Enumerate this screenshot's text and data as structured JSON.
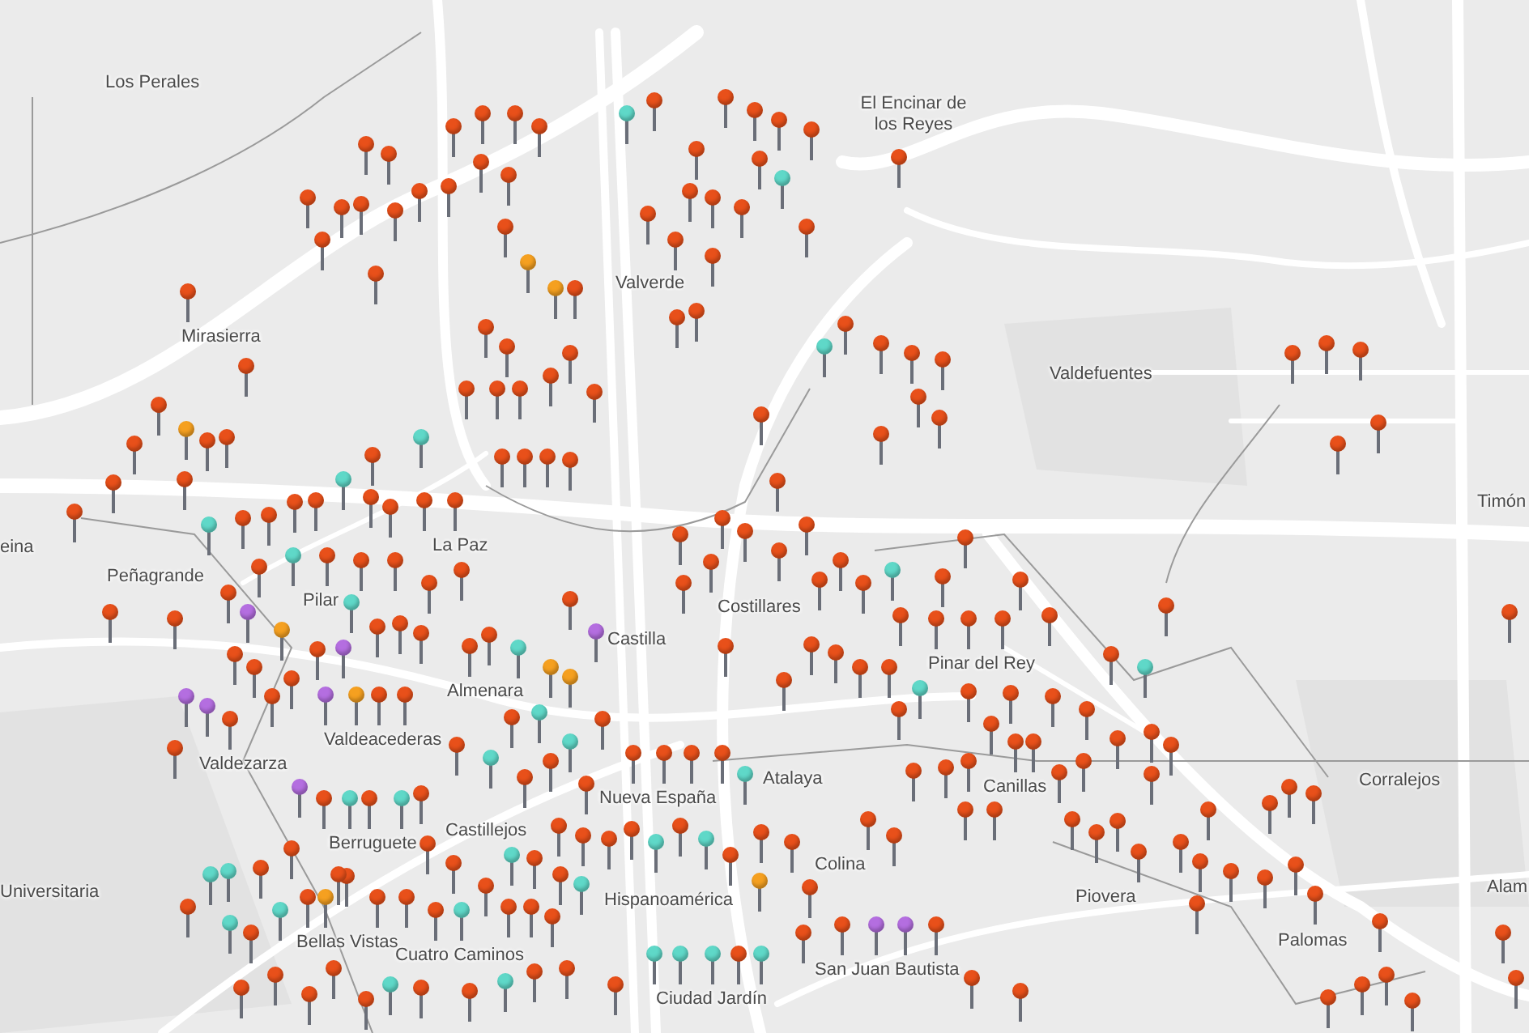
{
  "map": {
    "place_labels": [
      {
        "text": "Los Perales"
      },
      {
        "text": "El Encinar de los Reyes"
      },
      {
        "text": "Valverde"
      },
      {
        "text": "Mirasierra"
      },
      {
        "text": "Valdefuentes"
      },
      {
        "text": "Timón"
      },
      {
        "text": "eina"
      },
      {
        "text": "Peñagrande"
      },
      {
        "text": "La Paz"
      },
      {
        "text": "Pilar"
      },
      {
        "text": "Costillares"
      },
      {
        "text": "Castilla"
      },
      {
        "text": "Pinar del Rey"
      },
      {
        "text": "Almenara"
      },
      {
        "text": "Valdeacederas"
      },
      {
        "text": "Valdezarza"
      },
      {
        "text": "Atalaya"
      },
      {
        "text": "Canillas"
      },
      {
        "text": "Corralejos"
      },
      {
        "text": "Nueva España"
      },
      {
        "text": "Castillejos"
      },
      {
        "text": "Berruguete"
      },
      {
        "text": "Colina"
      },
      {
        "text": "Alam"
      },
      {
        "text": "Universitaria"
      },
      {
        "text": "Hispanoamérica"
      },
      {
        "text": "Piovera"
      },
      {
        "text": "Palomas"
      },
      {
        "text": "Bellas Vistas"
      },
      {
        "text": "Cuatro Caminos"
      },
      {
        "text": "San Juan Bautista"
      },
      {
        "text": "Ciudad Jardín"
      }
    ],
    "pins": [
      {
        "color": "#e8501a"
      },
      {
        "color": "#e8501a"
      },
      {
        "color": "#e8501a"
      },
      {
        "color": "#e8501a"
      },
      {
        "color": "#e8501a"
      },
      {
        "color": "#e8501a"
      },
      {
        "color": "#e8501a"
      },
      {
        "color": "#e8501a"
      },
      {
        "color": "#e8501a"
      },
      {
        "color": "#e8501a"
      },
      {
        "color": "#e8501a"
      },
      {
        "color": "#e8501a"
      },
      {
        "color": "#e8501a"
      },
      {
        "color": "#e8501a"
      },
      {
        "color": "#e8501a"
      },
      {
        "color": "#e8501a"
      },
      {
        "color": "#e8501a"
      },
      {
        "color": "#5fd8c8"
      },
      {
        "color": "#e8501a"
      },
      {
        "color": "#e8501a"
      },
      {
        "color": "#e8501a"
      },
      {
        "color": "#e8501a"
      },
      {
        "color": "#e8501a"
      },
      {
        "color": "#5fd8c8"
      },
      {
        "color": "#e8501a"
      },
      {
        "color": "#e8501a"
      },
      {
        "color": "#e8501a"
      },
      {
        "color": "#e8501a"
      },
      {
        "color": "#e8501a"
      },
      {
        "color": "#e8501a"
      },
      {
        "color": "#e8501a"
      },
      {
        "color": "#e8501a"
      },
      {
        "color": "#e8501a"
      },
      {
        "color": "#e8501a"
      },
      {
        "color": "#f5a020"
      },
      {
        "color": "#f5a020"
      },
      {
        "color": "#e8501a"
      },
      {
        "color": "#e8501a"
      },
      {
        "color": "#e8501a"
      },
      {
        "color": "#e8501a"
      },
      {
        "color": "#e8501a"
      },
      {
        "color": "#e8501a"
      },
      {
        "color": "#e8501a"
      },
      {
        "color": "#e8501a"
      },
      {
        "color": "#e8501a"
      },
      {
        "color": "#e8501a"
      },
      {
        "color": "#e8501a"
      },
      {
        "color": "#e8501a"
      },
      {
        "color": "#e8501a"
      },
      {
        "color": "#e8501a"
      },
      {
        "color": "#e8501a"
      },
      {
        "color": "#e8501a"
      },
      {
        "color": "#e8501a"
      },
      {
        "color": "#e8501a"
      },
      {
        "color": "#e8501a"
      },
      {
        "color": "#5fd8c8"
      },
      {
        "color": "#e8501a"
      },
      {
        "color": "#e8501a"
      },
      {
        "color": "#e8501a"
      },
      {
        "color": "#e8501a"
      },
      {
        "color": "#e8501a"
      },
      {
        "color": "#e8501a"
      },
      {
        "color": "#e8501a"
      },
      {
        "color": "#e8501a"
      },
      {
        "color": "#e8501a"
      },
      {
        "color": "#e8501a"
      },
      {
        "color": "#e8501a"
      },
      {
        "color": "#e8501a"
      },
      {
        "color": "#e8501a"
      },
      {
        "color": "#e8501a"
      },
      {
        "color": "#e8501a"
      },
      {
        "color": "#e8501a"
      },
      {
        "color": "#e8501a"
      },
      {
        "color": "#e8501a"
      },
      {
        "color": "#f5a020"
      },
      {
        "color": "#e8501a"
      },
      {
        "color": "#5fd8c8"
      },
      {
        "color": "#5fd8c8"
      },
      {
        "color": "#e8501a"
      },
      {
        "color": "#e8501a"
      },
      {
        "color": "#e8501a"
      },
      {
        "color": "#5fd8c8"
      },
      {
        "color": "#e8501a"
      },
      {
        "color": "#5fd8c8"
      },
      {
        "color": "#e8501a"
      },
      {
        "color": "#e8501a"
      },
      {
        "color": "#e8501a"
      },
      {
        "color": "#e8501a"
      },
      {
        "color": "#e8501a"
      },
      {
        "color": "#e8501a"
      },
      {
        "color": "#e8501a"
      },
      {
        "color": "#f5a020"
      },
      {
        "color": "#5fd8c8"
      },
      {
        "color": "#e8501a"
      },
      {
        "color": "#e8501a"
      },
      {
        "color": "#e8501a"
      },
      {
        "color": "#e8501a"
      },
      {
        "color": "#e8501a"
      },
      {
        "color": "#e8501a"
      },
      {
        "color": "#e8501a"
      },
      {
        "color": "#e8501a"
      },
      {
        "color": "#e8501a"
      },
      {
        "color": "#e8501a"
      },
      {
        "color": "#b46ee0"
      },
      {
        "color": "#e8501a"
      },
      {
        "color": "#b46ee0"
      },
      {
        "color": "#e8501a"
      },
      {
        "color": "#e8501a"
      },
      {
        "color": "#e8501a"
      },
      {
        "color": "#e8501a"
      },
      {
        "color": "#e8501a"
      },
      {
        "color": "#e8501a"
      },
      {
        "color": "#e8501a"
      },
      {
        "color": "#e8501a"
      },
      {
        "color": "#e8501a"
      },
      {
        "color": "#e8501a"
      },
      {
        "color": "#e8501a"
      },
      {
        "color": "#e8501a"
      },
      {
        "color": "#e8501a"
      },
      {
        "color": "#e8501a"
      },
      {
        "color": "#5fd8c8"
      },
      {
        "color": "#f5a020"
      },
      {
        "color": "#e8501a"
      },
      {
        "color": "#b46ee0"
      },
      {
        "color": "#f5a020"
      },
      {
        "color": "#e8501a"
      },
      {
        "color": "#5fd8c8"
      },
      {
        "color": "#e8501a"
      },
      {
        "color": "#5fd8c8"
      },
      {
        "color": "#e8501a"
      },
      {
        "color": "#e8501a"
      },
      {
        "color": "#5fd8c8"
      },
      {
        "color": "#e8501a"
      },
      {
        "color": "#e8501a"
      },
      {
        "color": "#e8501a"
      },
      {
        "color": "#5fd8c8"
      },
      {
        "color": "#e8501a"
      },
      {
        "color": "#e8501a"
      },
      {
        "color": "#5fd8c8"
      },
      {
        "color": "#e8501a"
      },
      {
        "color": "#e8501a"
      },
      {
        "color": "#e8501a"
      },
      {
        "color": "#5fd8c8"
      },
      {
        "color": "#e8501a"
      },
      {
        "color": "#e8501a"
      },
      {
        "color": "#e8501a"
      },
      {
        "color": "#e8501a"
      },
      {
        "color": "#e8501a"
      },
      {
        "color": "#5fd8c8"
      },
      {
        "color": "#e8501a"
      },
      {
        "color": "#5fd8c8"
      },
      {
        "color": "#e8501a"
      },
      {
        "color": "#e8501a"
      },
      {
        "color": "#5fd8c8"
      },
      {
        "color": "#e8501a"
      },
      {
        "color": "#e8501a"
      },
      {
        "color": "#e8501a"
      },
      {
        "color": "#5fd8c8"
      },
      {
        "color": "#e8501a"
      },
      {
        "color": "#e8501a"
      },
      {
        "color": "#e8501a"
      },
      {
        "color": "#e8501a"
      },
      {
        "color": "#e8501a"
      },
      {
        "color": "#e8501a"
      },
      {
        "color": "#e8501a"
      },
      {
        "color": "#e8501a"
      },
      {
        "color": "#e8501a"
      },
      {
        "color": "#f5a020"
      },
      {
        "color": "#5fd8c8"
      },
      {
        "color": "#e8501a"
      },
      {
        "color": "#e8501a"
      },
      {
        "color": "#5fd8c8"
      },
      {
        "color": "#e8501a"
      },
      {
        "color": "#e8501a"
      },
      {
        "color": "#e8501a"
      },
      {
        "color": "#5fd8c8"
      },
      {
        "color": "#5fd8c8"
      },
      {
        "color": "#5fd8c8"
      },
      {
        "color": "#e8501a"
      },
      {
        "color": "#5fd8c8"
      },
      {
        "color": "#e8501a"
      },
      {
        "color": "#e8501a"
      },
      {
        "color": "#5fd8c8"
      },
      {
        "color": "#e8501a"
      },
      {
        "color": "#e8501a"
      },
      {
        "color": "#e8501a"
      },
      {
        "color": "#e8501a"
      },
      {
        "color": "#e8501a"
      },
      {
        "color": "#e8501a"
      },
      {
        "color": "#5fd8c8"
      },
      {
        "color": "#e8501a"
      },
      {
        "color": "#e8501a"
      },
      {
        "color": "#e8501a"
      },
      {
        "color": "#f5a020"
      },
      {
        "color": "#e8501a"
      },
      {
        "color": "#e8501a"
      },
      {
        "color": "#e8501a"
      },
      {
        "color": "#e8501a"
      },
      {
        "color": "#e8501a"
      },
      {
        "color": "#b46ee0"
      },
      {
        "color": "#b46ee0"
      },
      {
        "color": "#e8501a"
      },
      {
        "color": "#e8501a"
      },
      {
        "color": "#e8501a"
      },
      {
        "color": "#e8501a"
      },
      {
        "color": "#5fd8c8"
      },
      {
        "color": "#e8501a"
      },
      {
        "color": "#e8501a"
      },
      {
        "color": "#e8501a"
      },
      {
        "color": "#e8501a"
      },
      {
        "color": "#e8501a"
      },
      {
        "color": "#e8501a"
      },
      {
        "color": "#e8501a"
      },
      {
        "color": "#e8501a"
      },
      {
        "color": "#e8501a"
      },
      {
        "color": "#5fd8c8"
      },
      {
        "color": "#e8501a"
      },
      {
        "color": "#e8501a"
      },
      {
        "color": "#e8501a"
      },
      {
        "color": "#e8501a"
      },
      {
        "color": "#e8501a"
      },
      {
        "color": "#e8501a"
      },
      {
        "color": "#e8501a"
      },
      {
        "color": "#e8501a"
      },
      {
        "color": "#e8501a"
      },
      {
        "color": "#e8501a"
      },
      {
        "color": "#e8501a"
      },
      {
        "color": "#e8501a"
      },
      {
        "color": "#e8501a"
      },
      {
        "color": "#5fd8c8"
      },
      {
        "color": "#e8501a"
      },
      {
        "color": "#e8501a"
      },
      {
        "color": "#e8501a"
      },
      {
        "color": "#e8501a"
      },
      {
        "color": "#e8501a"
      },
      {
        "color": "#e8501a"
      },
      {
        "color": "#e8501a"
      },
      {
        "color": "#e8501a"
      },
      {
        "color": "#e8501a"
      },
      {
        "color": "#e8501a"
      },
      {
        "color": "#e8501a"
      },
      {
        "color": "#e8501a"
      },
      {
        "color": "#e8501a"
      },
      {
        "color": "#e8501a"
      },
      {
        "color": "#e8501a"
      },
      {
        "color": "#e8501a"
      },
      {
        "color": "#e8501a"
      },
      {
        "color": "#e8501a"
      },
      {
        "color": "#e8501a"
      },
      {
        "color": "#e8501a"
      },
      {
        "color": "#e8501a"
      },
      {
        "color": "#e8501a"
      },
      {
        "color": "#e8501a"
      },
      {
        "color": "#e8501a"
      },
      {
        "color": "#e8501a"
      },
      {
        "color": "#e8501a"
      },
      {
        "color": "#e8501a"
      },
      {
        "color": "#e8501a"
      },
      {
        "color": "#e8501a"
      },
      {
        "color": "#e8501a"
      },
      {
        "color": "#e8501a"
      },
      {
        "color": "#e8501a"
      },
      {
        "color": "#e8501a"
      },
      {
        "color": "#e8501a"
      },
      {
        "color": "#e8501a"
      },
      {
        "color": "#b46ee0"
      },
      {
        "color": "#b46ee0"
      },
      {
        "color": "#e8501a"
      },
      {
        "color": "#e8501a"
      },
      {
        "color": "#e8501a"
      },
      {
        "color": "#b46ee0"
      },
      {
        "color": "#f5a020"
      },
      {
        "color": "#e8501a"
      },
      {
        "color": "#e8501a"
      },
      {
        "color": "#b46ee0"
      },
      {
        "color": "#5fd8c8"
      },
      {
        "color": "#5fd8c8"
      },
      {
        "color": "#e8501a"
      },
      {
        "color": "#e8501a"
      },
      {
        "color": "#5fd8c8"
      }
    ]
  }
}
